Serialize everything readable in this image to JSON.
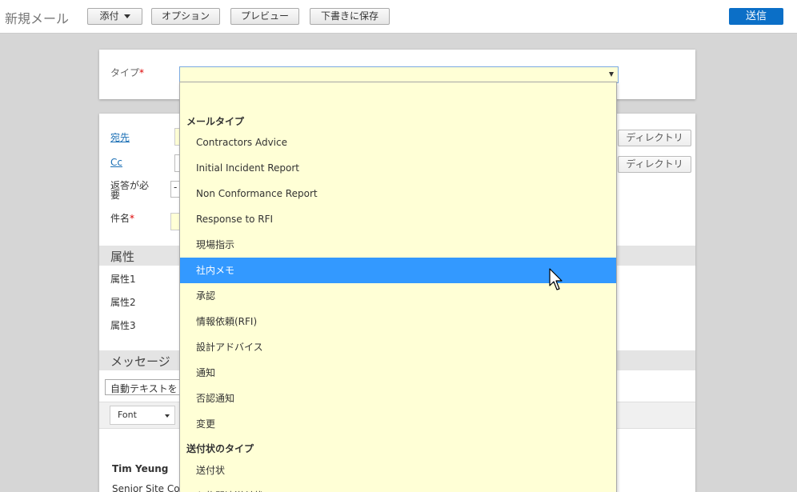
{
  "toolbar": {
    "title": "新規メール",
    "attach_label": "添付",
    "options_label": "オプション",
    "preview_label": "プレビュー",
    "save_draft_label": "下書きに保存",
    "send_label": "送信"
  },
  "type_field": {
    "label": "タイプ",
    "required_mark": "*",
    "value": ""
  },
  "address": {
    "to_label": "宛先",
    "cc_label": "Cc",
    "directory_label": "ディレクトリ",
    "reply_required_label": "返答が必要",
    "reply_value": "-",
    "subject_label": "件名",
    "subject_required_mark": "*"
  },
  "attributes": {
    "section_title": "属性",
    "items": [
      "属性1",
      "属性2",
      "属性3"
    ]
  },
  "message": {
    "section_title": "メッセージ",
    "auto_text_placeholder": "自動テキストを",
    "font_label": "Font"
  },
  "signature": {
    "name": "Tim Yeung",
    "title": "Senior Site Coo"
  },
  "dropdown": {
    "groups": [
      {
        "label": "メールタイプ",
        "options": [
          "Contractors Advice",
          "Initial Incident Report",
          "Non Conformance Report",
          "Response to RFI",
          "現場指示",
          "社内メモ",
          "承認",
          "情報依頼(RFI)",
          "設計アドバイス",
          "通知",
          "否認通知",
          "変更"
        ]
      },
      {
        "label": "送付状のタイプ",
        "options": [
          "送付状",
          "入札関連送付状"
        ]
      }
    ],
    "highlighted": "社内メモ"
  },
  "colors": {
    "accent": "#0b6fc7",
    "highlight": "#3399ff",
    "field_yellow": "#ffffd6"
  }
}
